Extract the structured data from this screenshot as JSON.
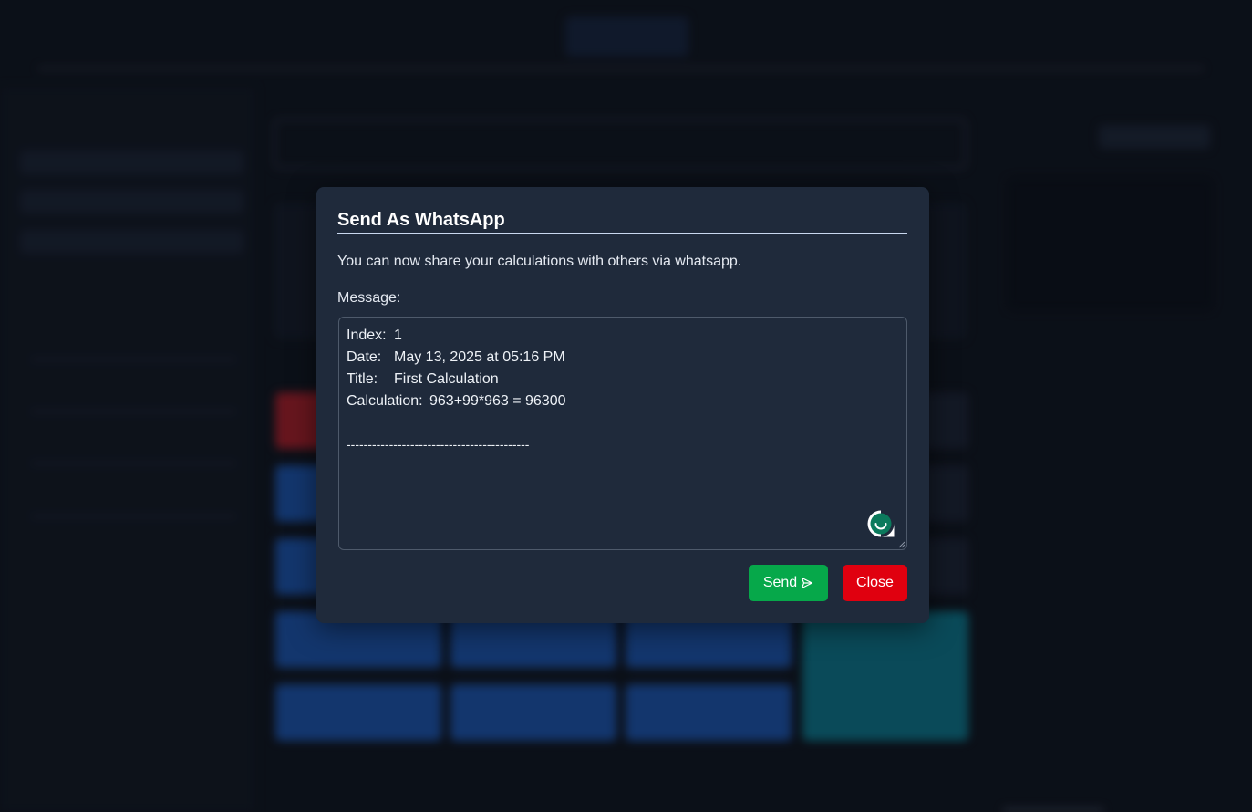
{
  "modal": {
    "title": "Send As WhatsApp",
    "description": "You can now share your calculations with others via whatsapp.",
    "message_label": "Message:",
    "message": {
      "index_key": "Index:",
      "index_value": "1",
      "date_key": "Date:",
      "date_value": "May 13, 2025 at 05:16 PM",
      "title_key": "Title:",
      "title_value": "First Calculation",
      "calc_key": "Calculation:",
      "calc_value": "963+99*963 = 96300",
      "separator": "-------------------------------------------"
    },
    "send_label": "Send",
    "send_icon": "send-arrow-icon",
    "close_label": "Close",
    "colors": {
      "send": "#06a84a",
      "close": "#e0000f",
      "background": "#1f2a3b"
    }
  }
}
